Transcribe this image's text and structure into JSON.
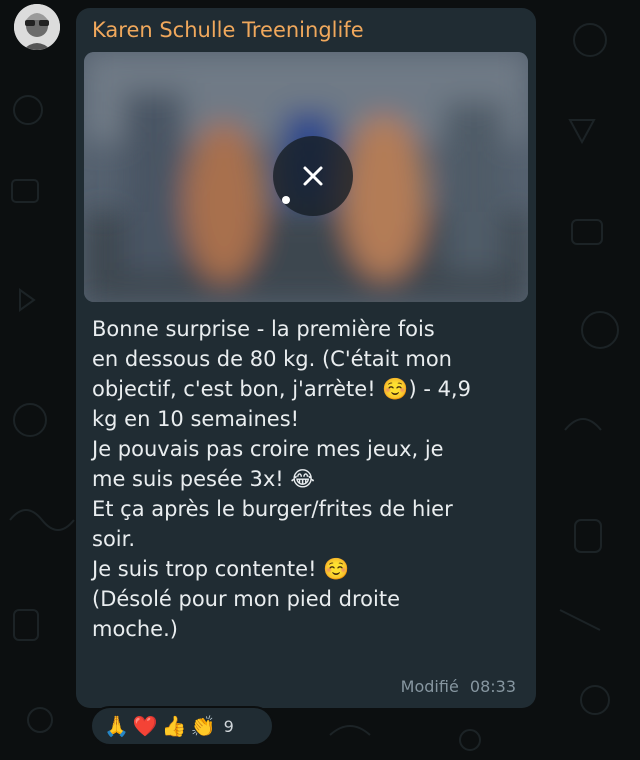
{
  "message": {
    "sender": "Karen Schulle Treeninglife",
    "text": "Bonne surprise - la première fois\nen dessous de 80 kg. (C'était mon\nobjectif, c'est bon, j'arrète! ☺️) - 4,9\nkg en 10 semaines!\nJe pouvais pas croire mes jeux, je\nme suis pesée 3x! 😂\nEt ça après le burger/frites de hier\nsoir.\nJe suis trop contente! ☺️\n(Désolé pour mon pied droite\nmoche.)",
    "edited_label": "Modifié",
    "time": "08:33"
  },
  "media": {
    "download_icon": "close-icon"
  },
  "reactions": {
    "emojis": [
      "🙏",
      "❤️",
      "👍",
      "👏"
    ],
    "count": "9"
  },
  "colors": {
    "background": "#0c0f10",
    "bubble": "#202c33",
    "sender": "#f0a85c",
    "text": "#e9edef",
    "meta": "#8696a0"
  }
}
